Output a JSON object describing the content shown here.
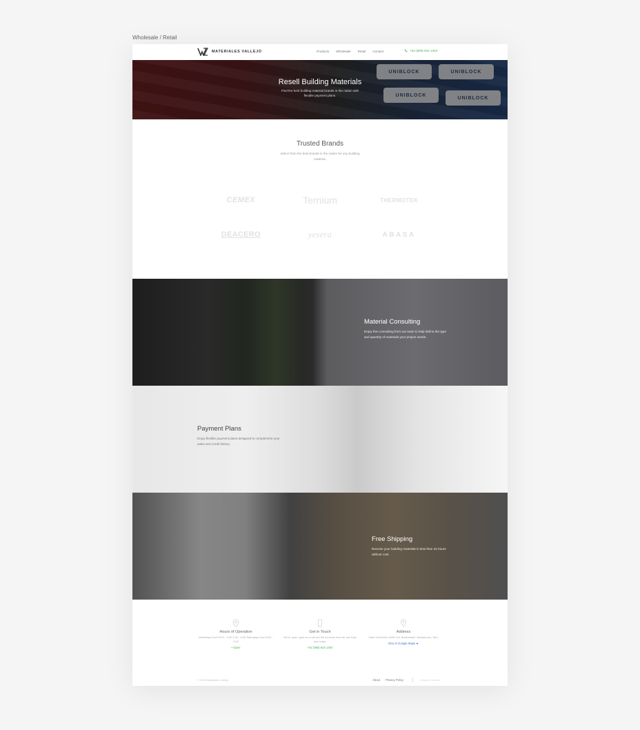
{
  "frame_label": "Wholesale / Retail",
  "header": {
    "logo_text": "MATERIALES VALLEJO",
    "nav": [
      "Products",
      "Wholesale",
      "Retail",
      "Contact"
    ],
    "phone": "+52 (868) 816 1353"
  },
  "hero": {
    "title": "Resell Building Materials",
    "subtitle": "Find the best building material brands in the nation with flexible payment plans.",
    "bag_label": "UNIBLOCK"
  },
  "brands": {
    "title": "Trusted Brands",
    "subtitle": "Select from the best brands in the nation for any building material.",
    "items": [
      "CEMEX",
      "Ternium",
      "THERMOTEK",
      "DEACERO",
      "yesera",
      "ABASA"
    ]
  },
  "features": {
    "consulting": {
      "title": "Material Consulting",
      "desc": "Enjoy free consulting from our team to help define the type and quantity of materials your project needs."
    },
    "payment": {
      "title": "Payment Plans",
      "desc": "Enjoy flexible payment plans designed to complement your sales and credit history."
    },
    "shipping": {
      "title": "Free Shipping",
      "desc": "Receive your building materials in less than 24 hours without cost."
    }
  },
  "info": {
    "hours": {
      "title": "Hours of Operation",
      "text": "Weekdays from 8:00 - 1:00 2:30 - 6:00 Saturdays from 8:00 - 2:00",
      "link": "• Open"
    },
    "contact": {
      "title": "Get in Touch",
      "text": "We're open, give us a call and let us know how we can help you today.",
      "link": "+52 (868) 816 1354"
    },
    "address": {
      "title": "Address",
      "text": "Calle Ozernicho #156 Col. Buenavista / Matamoros, Tam.",
      "link": "View in Google Maps  ►"
    }
  },
  "footer": {
    "copyright": "© 2016 Materiales Vallejo",
    "links": [
      "About",
      "Privacy Policy"
    ],
    "credit": "Made in Mexico"
  },
  "colors": {
    "accent_green": "#49b35a",
    "link_blue": "#3a7bd5"
  }
}
